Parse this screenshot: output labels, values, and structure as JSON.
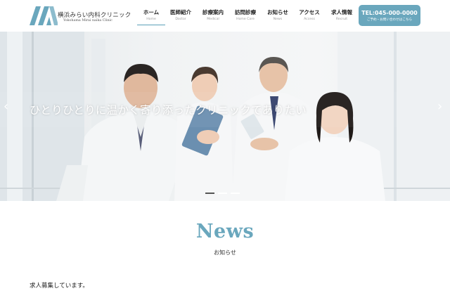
{
  "header": {
    "logo_ja": "横浜みらい内科クリニック",
    "logo_en": "Yokohama Mirai naika Clinic",
    "nav": [
      {
        "ja": "ホーム",
        "en": "Home"
      },
      {
        "ja": "医師紹介",
        "en": "Doctor"
      },
      {
        "ja": "診療案内",
        "en": "Medical"
      },
      {
        "ja": "訪問診療",
        "en": "Home Care"
      },
      {
        "ja": "お知らせ",
        "en": "News"
      },
      {
        "ja": "アクセス",
        "en": "Access"
      },
      {
        "ja": "求人情報",
        "en": "Recruit"
      }
    ],
    "tel": "TEL:045-000-0000",
    "tel_sub": "ご予約・お問い合わせはこちら"
  },
  "hero": {
    "catchphrase": "ひとりひとりに温かく寄り添ったクリニックでありたい",
    "prev_arrow": "‹",
    "next_arrow": "›"
  },
  "news": {
    "title": "News",
    "subtitle": "お知らせ",
    "items": [
      "求人募集しています。"
    ]
  },
  "colors": {
    "accent": "#6aa7bd",
    "logo_mark": "#6aa7bd",
    "text": "#222222"
  }
}
